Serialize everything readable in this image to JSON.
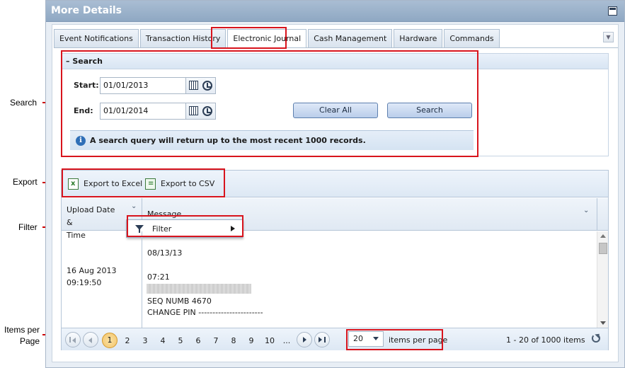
{
  "callouts": {
    "search": "Search",
    "export": "Export",
    "filter": "Filter",
    "items_per_page_line1": "Items per",
    "items_per_page_line2": "Page"
  },
  "window": {
    "title": "More Details"
  },
  "tabs": [
    {
      "label": "Event Notifications"
    },
    {
      "label": "Transaction History"
    },
    {
      "label": "Electronic Journal"
    },
    {
      "label": "Cash Management"
    },
    {
      "label": "Hardware"
    },
    {
      "label": "Commands"
    }
  ],
  "active_tab": "Electronic Journal",
  "search": {
    "header": "Search",
    "start_label": "Start:",
    "start_value": "01/01/2013",
    "end_label": "End:",
    "end_value": "01/01/2014",
    "clear_all_label": "Clear All",
    "search_label": "Search",
    "info_text": "A search query will return up to the most recent 1000 records."
  },
  "toolbar": {
    "export_excel": "Export to Excel",
    "export_csv": "Export to CSV"
  },
  "columns": {
    "upload_line1": "Upload Date &",
    "upload_line2": "Time",
    "message": "Message"
  },
  "filter_menu": {
    "label": "Filter"
  },
  "row": {
    "date": "16 Aug 2013",
    "time": "09:19:50",
    "message_lines": [
      "08/13/13",
      "07:21",
      "SEQ NUMB 4670",
      "CHANGE PIN -----------------------"
    ]
  },
  "pager": {
    "pages": [
      "1",
      "2",
      "3",
      "4",
      "5",
      "6",
      "7",
      "8",
      "9",
      "10",
      "..."
    ],
    "current_page": "1",
    "page_size": "20",
    "items_per_page_label": "items per page",
    "range": "1 - 20 of 1000 items"
  },
  "colors": {
    "callout_red": "#d8141d",
    "header_blue": "#9cb3cc",
    "active_page": "#f2c36b"
  }
}
